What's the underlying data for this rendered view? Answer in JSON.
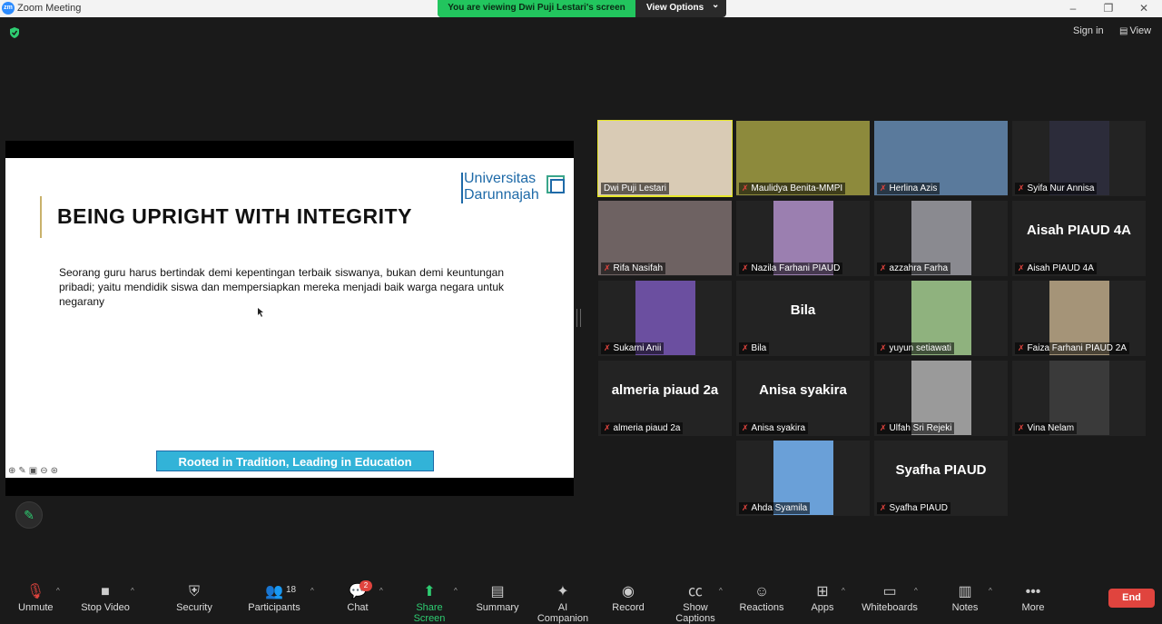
{
  "window": {
    "title": "Zoom Meeting",
    "minimize": "–",
    "maximize": "❐",
    "close": "✕"
  },
  "banner": {
    "viewing": "You are viewing Dwi Puji Lestari's screen",
    "view_options": "View Options",
    "caret": "⌄"
  },
  "top": {
    "sign_in": "Sign in",
    "view": "View"
  },
  "slide": {
    "title": "BEING UPRIGHT WITH INTEGRITY",
    "body": "Seorang guru harus bertindak demi kepentingan terbaik siswanya, bukan demi keuntungan pribadi; yaitu mendidik siswa dan mempersiapkan mereka menjadi baik warga negara untuk negarany",
    "logo_line1": "Universitas",
    "logo_line2": "Darunnajah",
    "tagline": "Rooted in Tradition, Leading in Education",
    "tools": "⊕✎▣⊖⊛"
  },
  "participants": [
    {
      "name": "Dwi Puji Lestari",
      "type": "video",
      "color": "#d9cbb5"
    },
    {
      "name": "Maulidya Benita-MMPI",
      "type": "video",
      "color": "#8d8a3c"
    },
    {
      "name": "Herlina Azis",
      "type": "video",
      "color": "#5a7a9c"
    },
    {
      "name": "Syifa Nur Annisa",
      "type": "video",
      "color": "#2c2c3a"
    },
    {
      "name": "Rifa Nasifah",
      "type": "video",
      "color": "#6e6262"
    },
    {
      "name": "Nazila Farhani PIAUD",
      "type": "video",
      "color": "#9b7fb0"
    },
    {
      "name": "azzahra Farha",
      "type": "video",
      "color": "#8a8a90"
    },
    {
      "name": "Aisah PIAUD 4A",
      "type": "text",
      "display": "Aisah PIAUD 4A"
    },
    {
      "name": "Sukarni Anii",
      "type": "video",
      "color": "#6b4fa0"
    },
    {
      "name": "Bila",
      "type": "text",
      "display": "Bila"
    },
    {
      "name": "yuyun setiawati",
      "type": "video",
      "color": "#8fb27e"
    },
    {
      "name": "Faiza Farhani PIAUD 2A",
      "type": "video",
      "color": "#a59478"
    },
    {
      "name": "almeria piaud 2a",
      "type": "text",
      "display": "almeria piaud 2a"
    },
    {
      "name": "Anisa syakira",
      "type": "text",
      "display": "Anisa syakira"
    },
    {
      "name": "Ulfah Sri Rejeki",
      "type": "video",
      "color": "#9a9a9a"
    },
    {
      "name": "Vina Nelam",
      "type": "video",
      "color": "#3a3a3a"
    },
    {
      "name": "Ahda Syamila",
      "type": "video",
      "color": "#6aa0d8"
    },
    {
      "name": "Syafha PIAUD",
      "type": "text",
      "display": "Syafha PIAUD"
    }
  ],
  "toolbar": {
    "unmute": "Unmute",
    "stop_video": "Stop Video",
    "security": "Security",
    "participants": "Participants",
    "participants_count": "18",
    "chat": "Chat",
    "chat_badge": "2",
    "share_screen": "Share Screen",
    "summary": "Summary",
    "ai_companion": "AI Companion",
    "record": "Record",
    "captions": "Show Captions",
    "reactions": "Reactions",
    "apps": "Apps",
    "whiteboards": "Whiteboards",
    "notes": "Notes",
    "more": "More",
    "end": "End"
  },
  "colors": {
    "accent_green": "#22c55e",
    "end_red": "#e0443e",
    "active_border": "#e6e62a"
  }
}
